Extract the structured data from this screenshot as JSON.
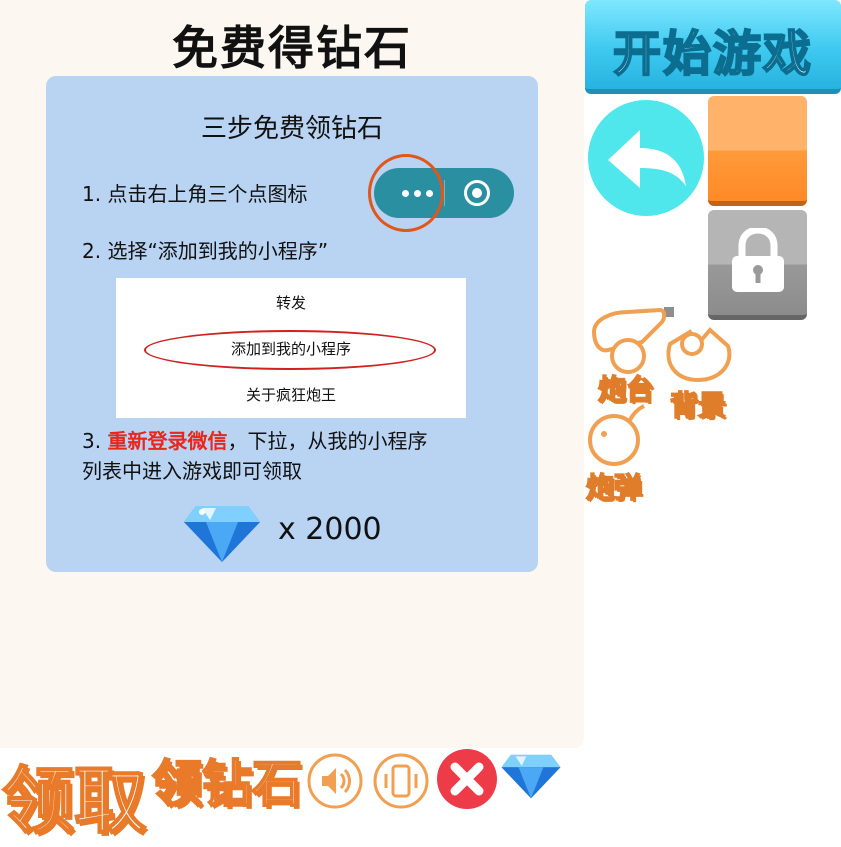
{
  "panel": {
    "title": "免费得钻石",
    "card": {
      "title": "三步免费领钻石",
      "step1": "1. 点击右上角三个点图标",
      "step2": "2. 选择“添加到我的小程序”",
      "menu_items": [
        "转发",
        "添加到我的小程序",
        "关于疯狂炮王"
      ],
      "step3_prefix": "3. ",
      "step3_highlight": "重新登录微信",
      "step3_line1_rest": "，下拉，从我的小程序",
      "step3_line2": "列表中进入游戏即可领取",
      "reward_text": "x  2000"
    }
  },
  "right": {
    "start_label": "开始游戏",
    "categories": [
      "炮台",
      "背景",
      "炮弹"
    ]
  },
  "bottom": {
    "claim_label": "领取",
    "diamond_label": "领钻石"
  },
  "colors": {
    "accent_blue": "#3fc9f0",
    "orange": "#ff9a3a",
    "card_bg": "#b9d3f2",
    "highlight_red": "#e8261c"
  }
}
